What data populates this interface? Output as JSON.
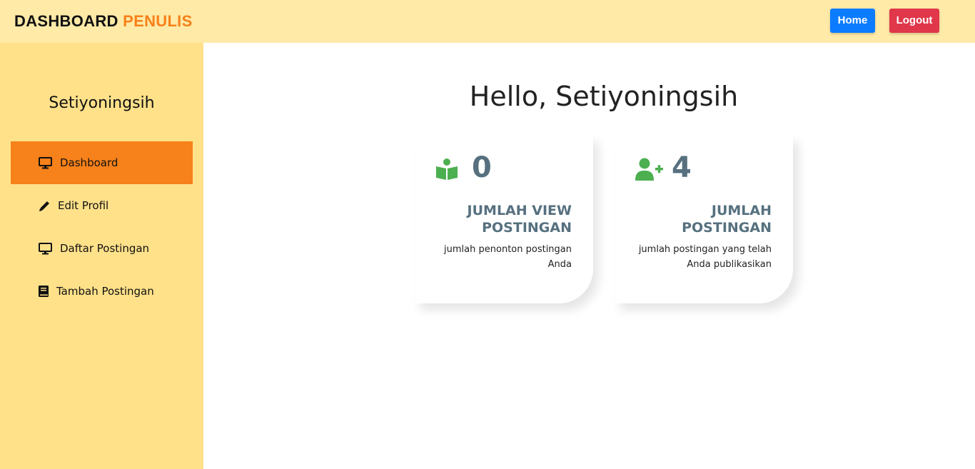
{
  "header": {
    "brand_primary": "DASHBOARD",
    "brand_accent": "PENULIS",
    "home_label": "Home",
    "logout_label": "Logout"
  },
  "sidebar": {
    "user_name": "Setiyoningsih",
    "items": [
      {
        "label": "Dashboard",
        "icon": "monitor-icon",
        "active": true
      },
      {
        "label": "Edit Profil",
        "icon": "pencil-icon",
        "active": false
      },
      {
        "label": "Daftar Postingan",
        "icon": "monitor-icon",
        "active": false
      },
      {
        "label": "Tambah Postingan",
        "icon": "book-icon",
        "active": false
      }
    ]
  },
  "main": {
    "greeting": "Hello, Setiyoningsih",
    "cards": [
      {
        "icon": "reader-icon",
        "value": "0",
        "title": "JUMLAH VIEW POSTINGAN",
        "description": "jumlah penonton postingan Anda"
      },
      {
        "icon": "user-plus-icon",
        "value": "4",
        "title": "JUMLAH POSTINGAN",
        "description": "jumlah postingan yang telah Anda publikasikan"
      }
    ]
  },
  "colors": {
    "topbar_bg": "#ffeaa7",
    "sidebar_bg": "#ffe18a",
    "accent_orange": "#f7811a",
    "home_blue": "#0b7cff",
    "logout_red": "#e0374a",
    "icon_green": "#4caf50",
    "card_text": "#56707f"
  }
}
